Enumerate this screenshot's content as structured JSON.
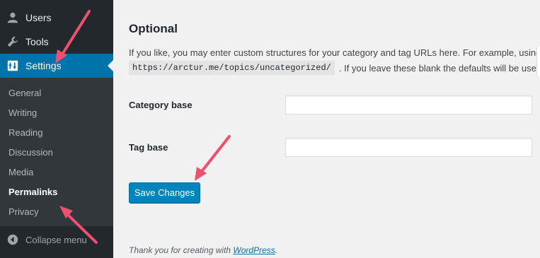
{
  "sidebar": {
    "top_items": [
      {
        "label": "Users",
        "icon": "users-icon"
      },
      {
        "label": "Tools",
        "icon": "wrench-icon"
      },
      {
        "label": "Settings",
        "icon": "settings-icon",
        "active": true
      }
    ],
    "submenu": [
      {
        "label": "General"
      },
      {
        "label": "Writing"
      },
      {
        "label": "Reading"
      },
      {
        "label": "Discussion"
      },
      {
        "label": "Media"
      },
      {
        "label": "Permalinks",
        "current": true
      },
      {
        "label": "Privacy"
      }
    ],
    "collapse_label": "Collapse menu"
  },
  "content": {
    "heading": "Optional",
    "description_start": "If you like, you may enter custom structures for your category and tag URLs here. For example, using",
    "description_code": "https://arctur.me/topics/uncategorized/",
    "description_end": ". If you leave these blank the defaults will be used.",
    "fields": {
      "category_base": {
        "label": "Category base",
        "value": ""
      },
      "tag_base": {
        "label": "Tag base",
        "value": ""
      }
    },
    "save_label": "Save Changes"
  },
  "footer": {
    "text": "Thank you for creating with ",
    "link": "WordPress",
    "end": "."
  },
  "colors": {
    "sidebar_bg": "#23282d",
    "submenu_bg": "#32373c",
    "active_menu": "#0073aa",
    "button_bg": "#0085ba",
    "annotation_arrow": "#f0506e"
  }
}
